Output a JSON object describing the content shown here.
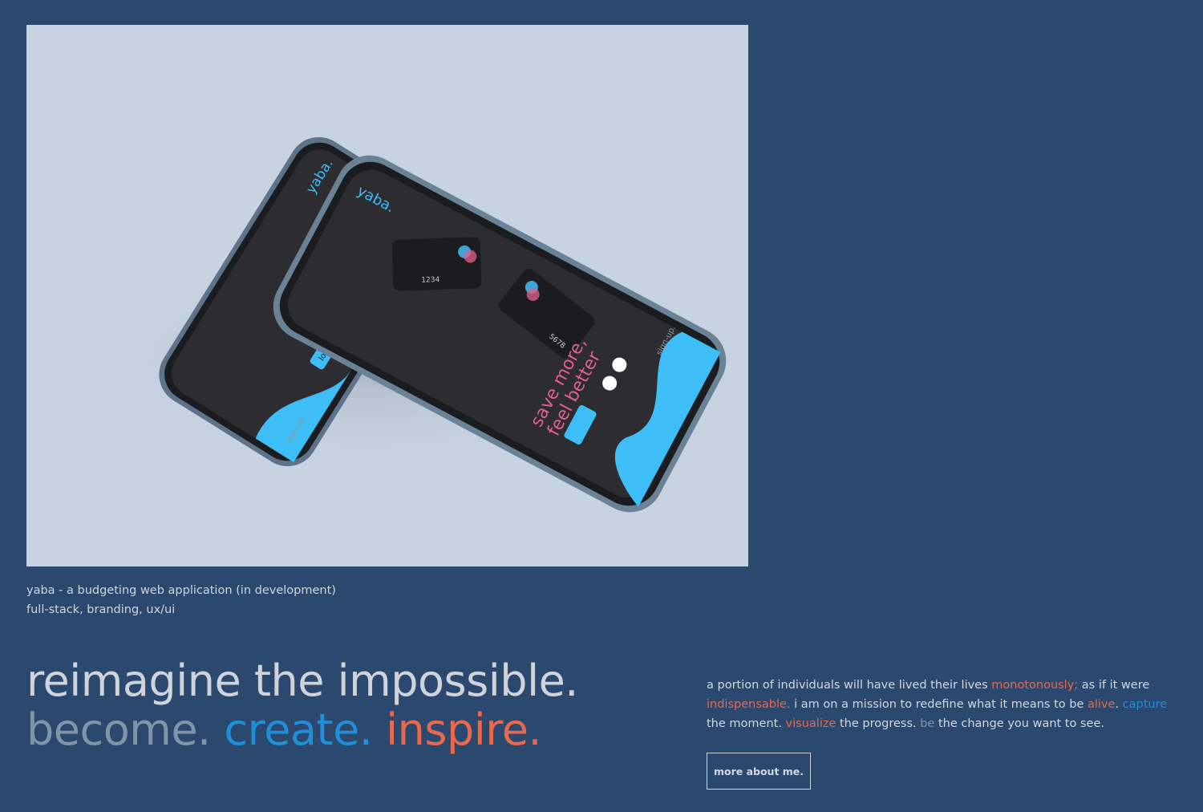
{
  "project": {
    "title": "yaba - a budgeting web application (in development)",
    "tags": "full-stack, branding, ux/ui",
    "mockup": {
      "brand": "yaba.",
      "tagline_1": "save more,",
      "tagline_2": "feel better",
      "login": "login.",
      "signup": "sign-up.",
      "card_1": "1234",
      "card_2": "5678"
    }
  },
  "headline": {
    "line1": "reimagine the impossible.",
    "word_become": "become.",
    "word_create": "create.",
    "word_inspire": "inspire."
  },
  "about": {
    "p1": "a portion of individuals will have lived their lives ",
    "monotonously": "monotonously;",
    "p2": " as if it were ",
    "indispensable": "indispensable.",
    "p3": " i am on a mission to redefine what it means to be ",
    "alive": "alive",
    "p4": ". ",
    "capture": "capture",
    "p5": " the moment. ",
    "visualize": "visualize",
    "p6": " the progress. ",
    "be": "be",
    "p7": " the change you want to see.",
    "button": "more about me."
  },
  "colors": {
    "background": "#2b486e",
    "accent_orange": "#e8694d",
    "accent_blue": "#1f8fd8",
    "muted": "#7f95a8",
    "screen_blue": "#3dbef7",
    "screen_pink": "#e0608e"
  }
}
